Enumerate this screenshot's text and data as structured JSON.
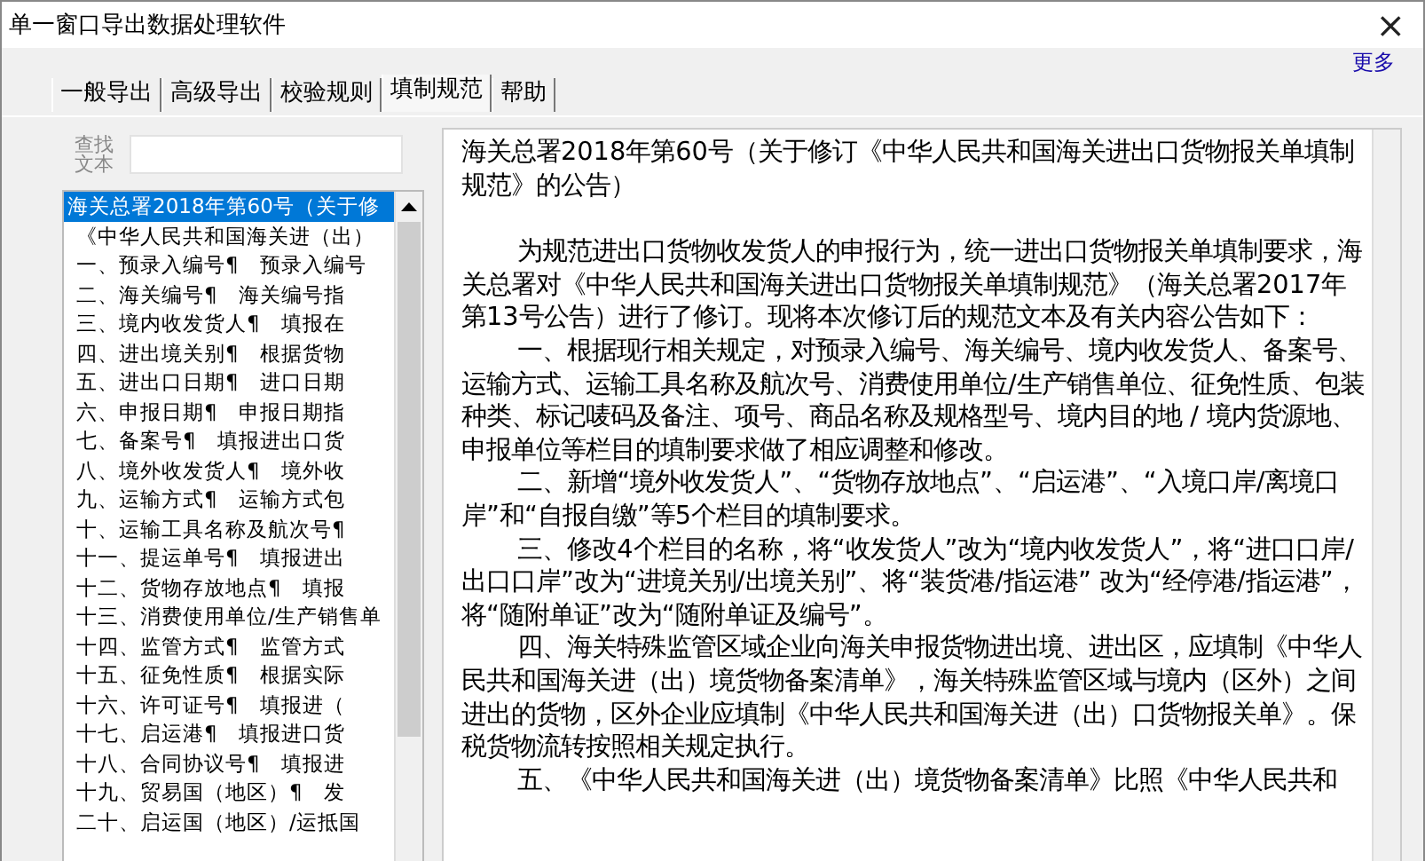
{
  "window": {
    "title": "单一窗口导出数据处理软件",
    "close": "×"
  },
  "more_link": "更多",
  "tabs": [
    {
      "label": "一般导出",
      "selected": false
    },
    {
      "label": "高级导出",
      "selected": false
    },
    {
      "label": "校验规则",
      "selected": false
    },
    {
      "label": "填制规范",
      "selected": true
    },
    {
      "label": "帮助",
      "selected": false
    }
  ],
  "search": {
    "label": "查找文本"
  },
  "list": {
    "items": [
      {
        "name": "海关总署2018年第60号（关于修",
        "selected": true
      },
      {
        "name": "《中华人民共和国海关进（出）",
        "selected": false
      },
      {
        "name": "一、预录入编号¶",
        "excerpt": "预录入编号",
        "selected": false
      },
      {
        "name": "二、海关编号¶",
        "excerpt": "海关编号指",
        "selected": false
      },
      {
        "name": "三、境内收发货人¶",
        "excerpt": "填报在",
        "selected": false
      },
      {
        "name": "四、进出境关别¶",
        "excerpt": "根据货物",
        "selected": false
      },
      {
        "name": "五、进出口日期¶",
        "excerpt": "进口日期",
        "selected": false
      },
      {
        "name": "六、申报日期¶",
        "excerpt": "申报日期指",
        "selected": false
      },
      {
        "name": "七、备案号¶",
        "excerpt": "填报进出口货",
        "selected": false
      },
      {
        "name": "八、境外收发货人¶",
        "excerpt": "境外收",
        "selected": false
      },
      {
        "name": "九、运输方式¶",
        "excerpt": "运输方式包",
        "selected": false
      },
      {
        "name": "十、运输工具名称及航次号¶",
        "selected": false
      },
      {
        "name": "十一、提运单号¶",
        "excerpt": "填报进出",
        "selected": false
      },
      {
        "name": "十二、货物存放地点¶",
        "excerpt": "填报",
        "selected": false
      },
      {
        "name": "十三、消费使用单位/生产销售单",
        "selected": false
      },
      {
        "name": "十四、监管方式¶",
        "excerpt": "监管方式",
        "selected": false
      },
      {
        "name": "十五、征免性质¶",
        "excerpt": "根据实际",
        "selected": false
      },
      {
        "name": "十六、许可证号¶",
        "excerpt": "填报进（",
        "selected": false
      },
      {
        "name": "十七、启运港¶",
        "excerpt": "填报进口货",
        "selected": false
      },
      {
        "name": "十八、合同协议号¶",
        "excerpt": "填报进",
        "selected": false
      },
      {
        "name": "十九、贸易国（地区）¶",
        "excerpt": "发",
        "selected": false
      },
      {
        "name": "二十、启运国（地区）/运抵国",
        "selected": false
      }
    ]
  },
  "document": {
    "title": "海关总署2018年第60号（关于修订《中华人民共和国海关进出口货物报关单填制规范》的公告）",
    "paragraphs": [
      "为规范进出口货物收发货人的申报行为，统一进出口货物报关单填制要求，海关总署对《中华人民共和国海关进出口货物报关单填制规范》（海关总署2017年第13号公告）进行了修订。现将本次修订后的规范文本及有关内容公告如下：",
      "一、根据现行相关规定，对预录入编号、海关编号、境内收发货人、备案号、运输方式、运输工具名称及航次号、消费使用单位/生产销售单位、征免性质、包装种类、标记唛码及备注、项号、商品名称及规格型号、境内目的地 / 境内货源地、申报单位等栏目的填制要求做了相应调整和修改。",
      "二、新增“境外收发货人”、“货物存放地点”、“启运港”、“入境口岸/离境口岸”和“自报自缴”等5个栏目的填制要求。",
      "三、修改4个栏目的名称，将“收发货人”改为“境内收发货人”，将“进口口岸/出口口岸”改为“进境关别/出境关别”、将“装货港/指运港” 改为“经停港/指运港”，将“随附单证”改为“随附单证及编号”。",
      "四、海关特殊监管区域企业向海关申报货物进出境、进出区，应填制《中华人民共和国海关进（出）境货物备案清单》，海关特殊监管区域与境内（区外）之间进出的货物，区外企业应填制《中华人民共和国海关进（出）口货物报关单》。保税货物流转按照相关规定执行。",
      "五、《中华人民共和国海关进（出）境货物备案清单》比照《中华人民共和"
    ]
  }
}
